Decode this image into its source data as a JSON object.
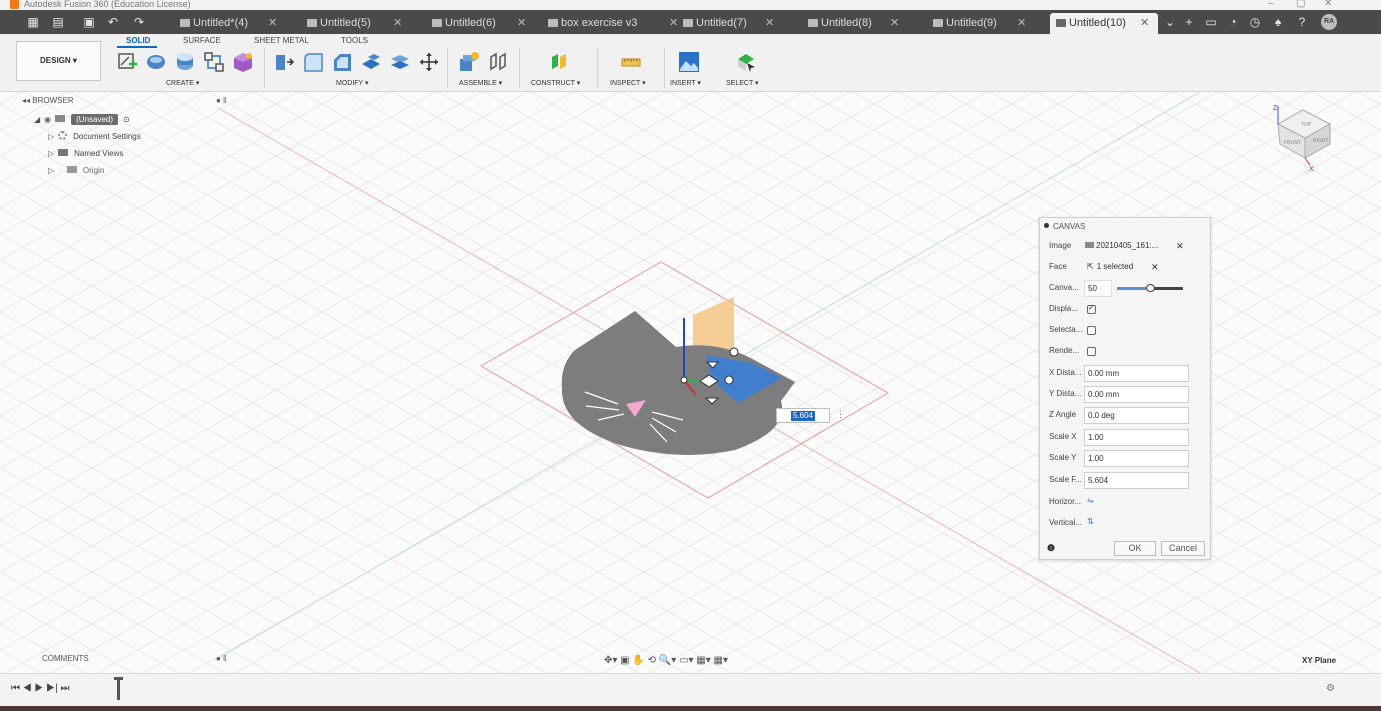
{
  "window": {
    "title": "Autodesk Fusion 360 (Education License)"
  },
  "quick_access": {
    "grid": "▦",
    "file": "▤",
    "save": "▣",
    "undo": "↶",
    "redo": "↷"
  },
  "tabs": [
    {
      "label": "Untitled*(4)"
    },
    {
      "label": "Untitled(5)"
    },
    {
      "label": "Untitled(6)"
    },
    {
      "label": "box exercise v3"
    },
    {
      "label": "Untitled(7)"
    },
    {
      "label": "Untitled(8)"
    },
    {
      "label": "Untitled(9)"
    },
    {
      "label": "Untitled(10)",
      "active": true
    }
  ],
  "user": {
    "initials": "RA"
  },
  "toolbar": {
    "design_label": "DESIGN ▾",
    "workspace_tabs": [
      "SOLID",
      "SURFACE",
      "SHEET METAL",
      "TOOLS"
    ],
    "groups": [
      "CREATE ▾",
      "MODIFY ▾",
      "ASSEMBLE ▾",
      "CONSTRUCT ▾",
      "INSPECT ▾",
      "INSERT ▾",
      "SELECT ▾"
    ]
  },
  "browser": {
    "title": "BROWSER",
    "root": "(Unsaved)",
    "items": [
      "Document Settings",
      "Named Views",
      "Origin"
    ]
  },
  "canvas_dialog": {
    "title": "CANVAS",
    "image_label": "Image",
    "image_value": "20210405_161:...",
    "face_label": "Face",
    "face_value": "1 selected",
    "opacity_label": "Canva...",
    "opacity_value": "50",
    "opacity_fraction": 0.5,
    "display_label": "Displa...",
    "display_checked": true,
    "selectable_label": "Selecta...",
    "selectable_checked": false,
    "render_label": "Rende...",
    "render_checked": false,
    "xdist_label": "X Dista...",
    "xdist_value": "0.00 mm",
    "ydist_label": "Y Dista...",
    "ydist_value": "0.00 mm",
    "zangle_label": "Z Angle",
    "zangle_value": "0.0 deg",
    "scalex_label": "Scale X",
    "scalex_value": "1.00",
    "scaley_label": "Scale Y",
    "scaley_value": "1.00",
    "scalef_label": "Scale F...",
    "scalef_value": "5.604",
    "horiz_label": "Horizor...",
    "vert_label": "Vertical...",
    "ok_label": "OK",
    "cancel_label": "Cancel"
  },
  "dimension_input": "5.604",
  "viewcube": {
    "top": "TOP",
    "front": "FRONT",
    "right": "RIGHT",
    "z": "Z",
    "x": "X"
  },
  "comments": {
    "title": "COMMENTS"
  },
  "navbar": "✥▾ ▣ ✋ ⟲ 🔍▾ ▭▾ ▦▾ ▦▾",
  "plane_label": "XY Plane",
  "timeline": {
    "controls": "⏮ ◀ ▶ ▶| ⏭"
  }
}
